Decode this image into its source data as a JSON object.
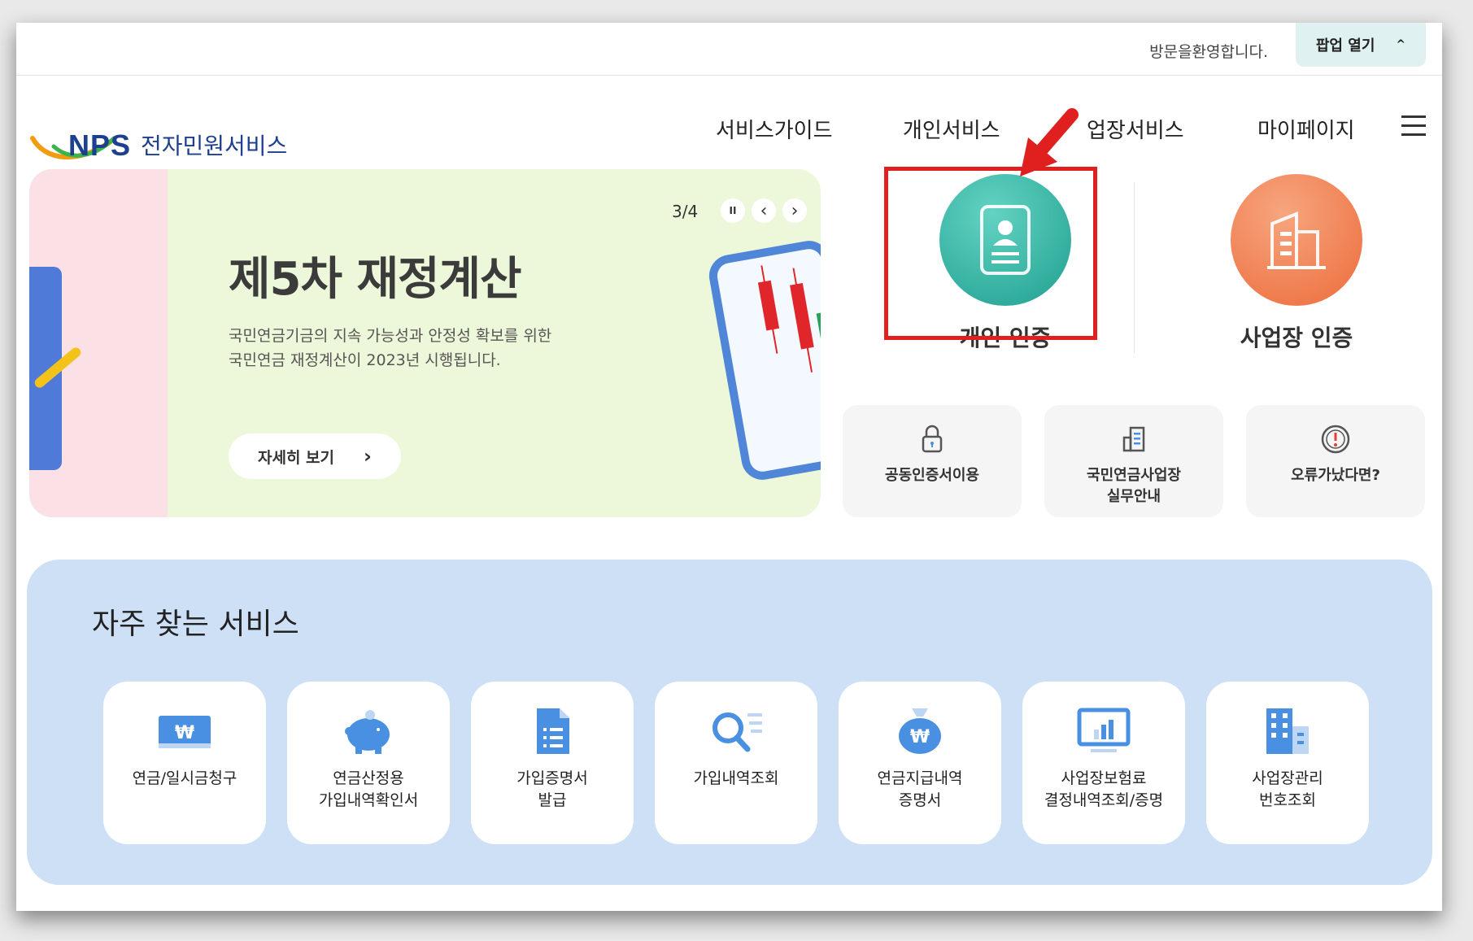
{
  "topbar": {
    "welcome": "방문을환영합니다.",
    "popup_label": "팝업 열기",
    "popup_chevron": "^"
  },
  "header": {
    "logo_brand": "NPS",
    "logo_service": "전자민원서비스",
    "nav": [
      "서비스가이드",
      "개인서비스",
      "업장서비스",
      "마이페이지"
    ]
  },
  "banner": {
    "counter": "3/4",
    "pause": "II",
    "prev": "‹",
    "next": "›",
    "title": "제5차 재정계산",
    "desc_line1": "국민연금기금의 지속 가능성과 안정성 확보를 위한",
    "desc_line2": "국민연금 재정계산이 2023년 시행됩니다.",
    "button_label": "자세히 보기",
    "button_chevron": "›"
  },
  "certs": {
    "personal": {
      "label": "개인 인증",
      "color": "#2fb6a4"
    },
    "business": {
      "label": "사업장 인증",
      "color": "#f0814f"
    }
  },
  "quick": [
    {
      "label": "공동인증서이용",
      "icon": "lock-icon"
    },
    {
      "label_line1": "국민연금사업장",
      "label_line2": "실무안내",
      "icon": "building-doc-icon"
    },
    {
      "label": "오류가났다면?",
      "icon": "alert-icon"
    }
  ],
  "frequent": {
    "title": "자주 찾는 서비스",
    "items": [
      {
        "line1": "연금/일시금청구",
        "line2": "",
        "icon": "won-card-icon"
      },
      {
        "line1": "연금산정용",
        "line2": "가입내역확인서",
        "icon": "piggy-bank-icon"
      },
      {
        "line1": "가입증명서",
        "line2": "발급",
        "icon": "document-icon"
      },
      {
        "line1": "가입내역조회",
        "line2": "",
        "icon": "search-list-icon"
      },
      {
        "line1": "연금지급내역",
        "line2": "증명서",
        "icon": "money-bag-icon"
      },
      {
        "line1": "사업장보험료",
        "line2": "결정내역조회/증명",
        "icon": "monitor-chart-icon"
      },
      {
        "line1": "사업장관리",
        "line2": "번호조회",
        "icon": "office-building-icon"
      }
    ]
  },
  "colors": {
    "accent_blue": "#1d3f8f",
    "icon_blue": "#4a90e2",
    "highlight_red": "#e01f1f"
  }
}
